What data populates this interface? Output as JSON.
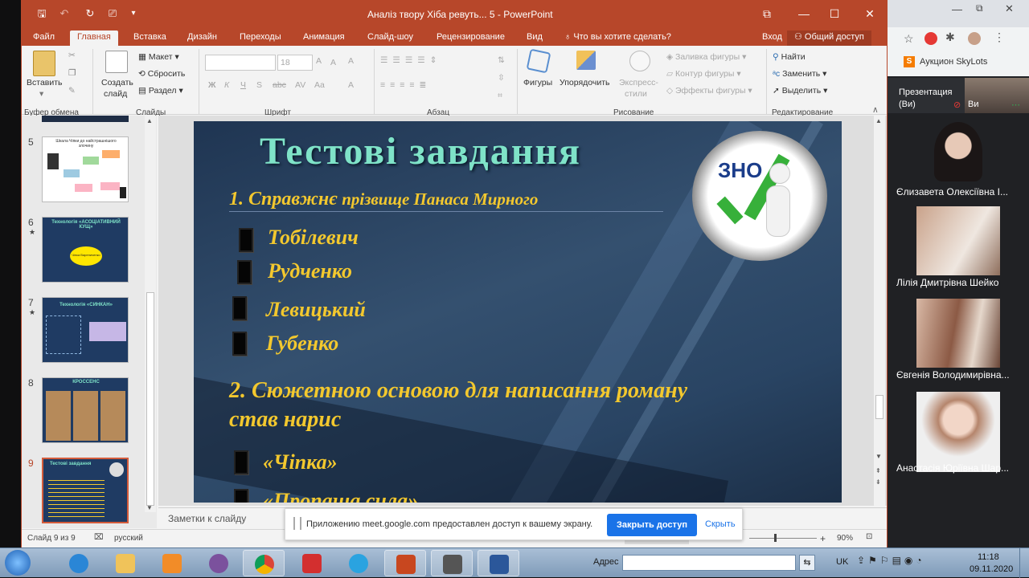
{
  "window": {
    "title": "Аналіз твору Хіба ревуть... 5 - PowerPoint"
  },
  "tabs": [
    "Файл",
    "Главная",
    "Вставка",
    "Дизайн",
    "Переходы",
    "Анимация",
    "Слайд-шоу",
    "Рецензирование",
    "Вид"
  ],
  "tellme": "Что вы хотите сделать?",
  "signin": "Вход",
  "share": "Общий доступ",
  "ribbon": {
    "paste": "Вставить",
    "new_slide": "Создать",
    "new_slide2": "слайд",
    "layout": "Макет",
    "reset": "Сбросить",
    "section": "Раздел",
    "font_size": "18",
    "shapes": "Фигуры",
    "arrange": "Упорядочить",
    "quick_styles": "Экспресс-",
    "quick_styles2": "стили",
    "fill": "Заливка фигуры",
    "outline": "Контур фигуры",
    "effects": "Эффекты фигуры",
    "find": "Найти",
    "replace": "Заменить",
    "select": "Выделить",
    "bold": "Ж",
    "italic": "К",
    "underline": "Ч",
    "strike": "S",
    "abc": "abc",
    "grow": "A",
    "shrink": "A",
    "clear": "A",
    "groups": {
      "clipboard": "Буфер обмена",
      "slides": "Слайды",
      "font": "Шрифт",
      "paragraph": "Абзац",
      "drawing": "Рисование",
      "editing": "Редактирование"
    }
  },
  "thumbnails": [
    {
      "num": "5",
      "star": "",
      "title": "Шкала Чіпки до найстрашнішого злочину"
    },
    {
      "num": "6",
      "star": "★",
      "title": "Технологія «АСОЦІАТИВНИЙ КУЩ»",
      "center": "Чіпка Варениченко"
    },
    {
      "num": "7",
      "star": "★",
      "title": "Технологія «СИНКАН»"
    },
    {
      "num": "8",
      "star": "",
      "title": "КРОССЕНС"
    },
    {
      "num": "9",
      "star": "",
      "title": "Тестові завдання"
    }
  ],
  "slide": {
    "title": "Тестові завдання",
    "badge": "ЗНО",
    "q1_a": "1. Справжнє",
    "q1_b": "прізвище Панаса Мирного",
    "answers1": [
      "Тобілевич",
      "Рудченко",
      "Левицький",
      "Губенко"
    ],
    "q2_line1": "2. Сюжетною основою для написання роману",
    "q2_line2": "став нарис",
    "answers2": [
      "«Чіпка»",
      "«Пропаща сила»"
    ]
  },
  "notes": "Заметки к слайду",
  "status": {
    "slide": "Слайд 9 из 9",
    "lang": "русский",
    "zoom": "90%",
    "fit": "+"
  },
  "share_banner": {
    "text": "Приложению meet.google.com предоставлен доступ к вашему экрану.",
    "stop": "Закрыть доступ",
    "hide": "Скрыть"
  },
  "browser": {
    "bookmark": "Аукцион SkyLots"
  },
  "meet": {
    "presentation": "Презентация",
    "presentation_you": "(Ви)",
    "you": "Ви",
    "participants": [
      "Єлизавета Олексіївна І...",
      "Лілія Дмитрівна Шейко",
      "Євгенія Володимирівна...",
      "Анастасія Юріївна Шар..."
    ]
  },
  "taskbar": {
    "address_label": "Адрес",
    "lang": "UK",
    "time": "11:18",
    "date": "09.11.2020"
  },
  "colors": {
    "accent": "#b7472a",
    "slide_title": "#7fe3c8",
    "slide_text": "#f3c82e",
    "meet_bg": "#202124",
    "button_blue": "#1a73e8"
  }
}
